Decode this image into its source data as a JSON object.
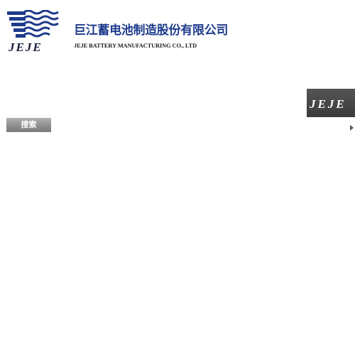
{
  "header": {
    "company_name_cn": "巨江蓄电池制造股份有限公司",
    "company_name_en": "JEJE BATTERY MANUFACTURING CO., LTD",
    "logo_text": "JEJE"
  },
  "sidebar": {
    "brand_badge_text": "JEJE"
  },
  "search": {
    "button_label": "搜索"
  },
  "navigation": {
    "arrow_icon": "triangle-right-icon"
  },
  "colors": {
    "brand_blue": "#1f3c8c",
    "logo_dark": "#1a1f3a",
    "text_dark": "#1a1a1a",
    "badge_bg": "#4a4a4a",
    "button_gray": "#8e8e8e",
    "arrow_gray": "#555555"
  }
}
